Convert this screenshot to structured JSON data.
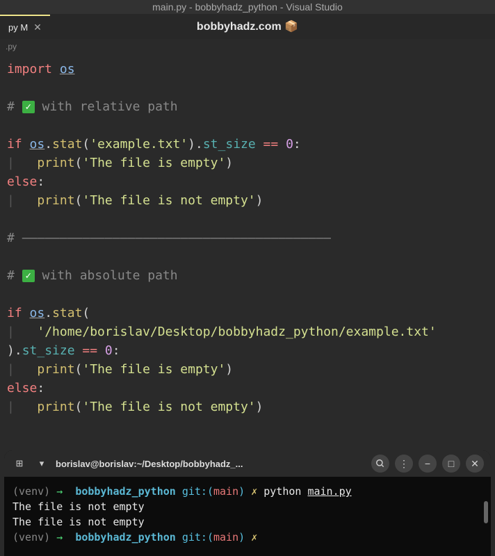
{
  "title_bar": "main.py - bobbyhadz_python - Visual Studio",
  "tab": {
    "label": "py M",
    "center": "bobbyhadz.com 📦"
  },
  "breadcrumb": ".py",
  "code": {
    "import_kw": "import",
    "os_module": "os",
    "comment1_prefix": "# ",
    "comment1_text": " with relative path",
    "if_kw": "if",
    "stat_func": "stat",
    "str_rel": "'example.txt'",
    "st_size": "st_size",
    "eq_op": "==",
    "zero": "0",
    "print_func": "print",
    "str_empty": "'The file is empty'",
    "else_kw": "else",
    "str_not_empty": "'The file is not empty'",
    "sep_comment": "# ",
    "sep_line": "—————————————————————————————————————————",
    "comment2_text": " with absolute path",
    "str_abs": "'/home/borislav/Desktop/bobbyhadz_python/example.txt'",
    "close_paren": ")"
  },
  "terminal": {
    "title": "borislav@borislav:~/Desktop/bobbyhadz_...",
    "venv": "(venv)",
    "arrow": "→",
    "dir": "bobbyhadz_python",
    "git_label": "git:(",
    "branch": "main",
    "git_close": ")",
    "x": "✗",
    "cmd": "python ",
    "file": "main.py",
    "out1": "The file is not empty",
    "out2": "The file is not empty"
  }
}
